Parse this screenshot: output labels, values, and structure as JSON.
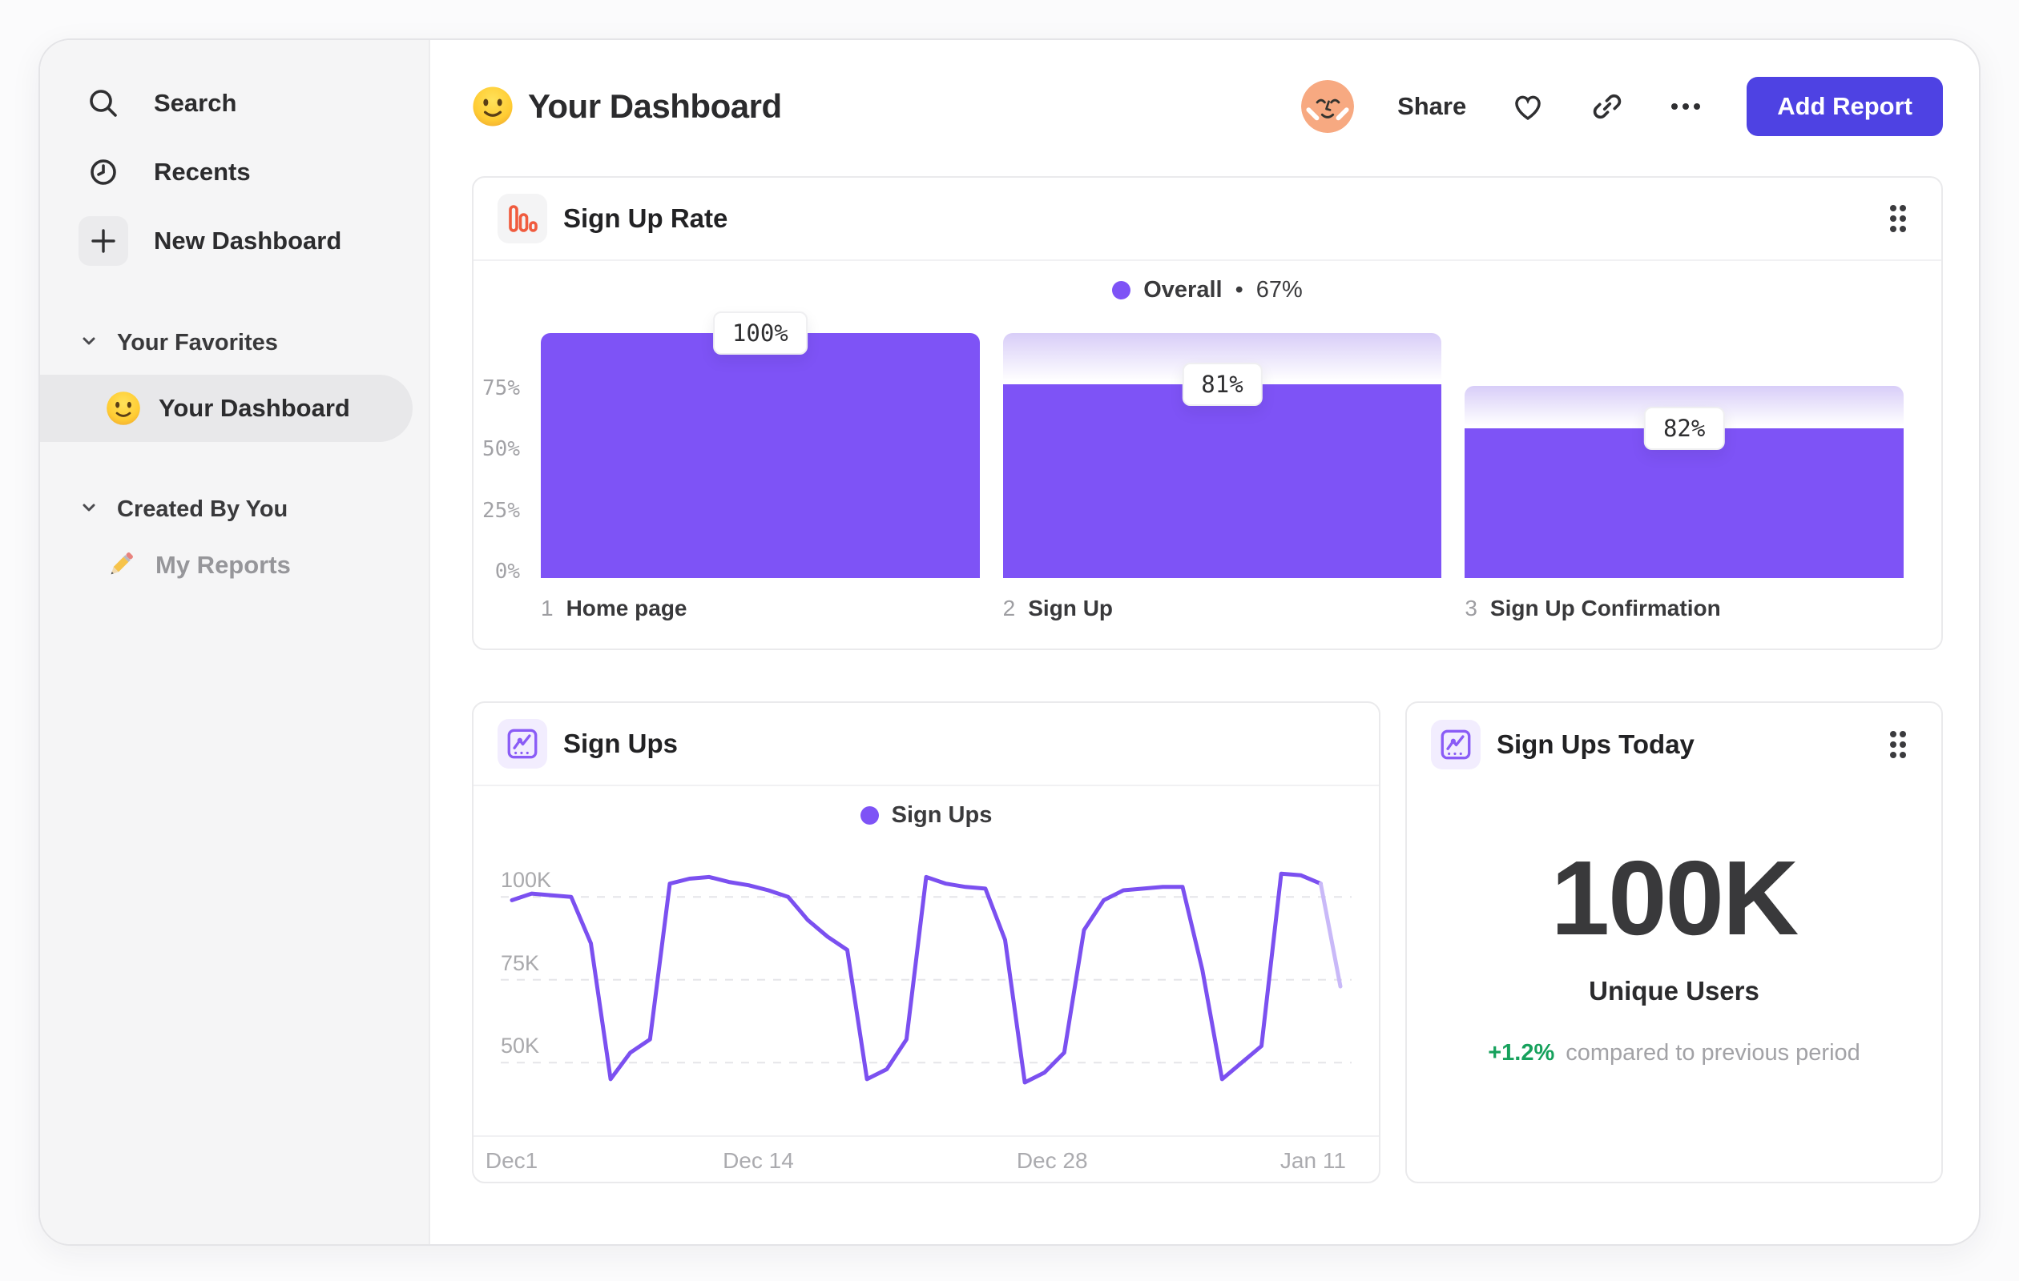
{
  "sidebar": {
    "items": [
      {
        "label": "Search",
        "icon": "search-icon"
      },
      {
        "label": "Recents",
        "icon": "clock-icon"
      },
      {
        "label": "New Dashboard",
        "icon": "plus-icon"
      }
    ],
    "sections": [
      {
        "label": "Your Favorites",
        "items": [
          {
            "label": "Your Dashboard",
            "emoji": "slightly-smiling-face",
            "active": true
          }
        ]
      },
      {
        "label": "Created By You",
        "items": [
          {
            "label": "My Reports",
            "emoji": "pencil",
            "active": false
          }
        ]
      }
    ]
  },
  "header": {
    "title": "Your Dashboard",
    "title_emoji": "slightly-smiling-face",
    "share_label": "Share",
    "add_report_label": "Add Report"
  },
  "cards": {
    "sign_up_rate": {
      "title": "Sign Up Rate"
    },
    "sign_ups": {
      "title": "Sign Ups"
    },
    "sign_ups_today": {
      "title": "Sign Ups Today",
      "value": "100K",
      "value_label": "Unique Users",
      "delta": "+1.2%",
      "delta_note": "compared to previous period"
    }
  },
  "chart_data": [
    {
      "id": "sign_up_rate",
      "type": "bar",
      "title": "Sign Up Rate",
      "legend": {
        "series": "Overall",
        "separator": "•",
        "value": "67%"
      },
      "ylim": [
        0,
        100
      ],
      "y_axis": {
        "ticks": [
          {
            "label": "75%",
            "value": 75
          },
          {
            "label": "50%",
            "value": 50
          },
          {
            "label": "25%",
            "value": 25
          },
          {
            "label": "0%",
            "value": 0
          }
        ]
      },
      "steps": [
        {
          "step": "1",
          "label": "Home page",
          "conversion": "100%",
          "bar_pct": 100,
          "fade_from_pct": 100
        },
        {
          "step": "2",
          "label": "Sign Up",
          "conversion": "81%",
          "bar_pct": 79,
          "fade_from_pct": 100
        },
        {
          "step": "3",
          "label": "Sign Up Confirmation",
          "conversion": "82%",
          "bar_pct": 61,
          "fade_from_pct": 78.5
        }
      ]
    },
    {
      "id": "sign_ups",
      "type": "line",
      "title": "Sign Ups",
      "legend": {
        "series": "Sign Ups"
      },
      "unit": "K",
      "grid": "dashed-horizontal",
      "y_axis": {
        "gridlines": [
          {
            "label": "100K",
            "value": 100
          },
          {
            "label": "75K",
            "value": 75
          },
          {
            "label": "50K",
            "value": 50
          }
        ],
        "value_at_top": 116,
        "value_at_bottom": 30
      },
      "x_axis": {
        "ticks": [
          {
            "label": "Dec1",
            "index": 0
          },
          {
            "label": "Dec 14",
            "index": 13
          },
          {
            "label": "Dec 28",
            "index": 27
          },
          {
            "label": "Jan 11",
            "index": 41
          }
        ]
      },
      "values_k": [
        99,
        101,
        100.5,
        100,
        86,
        45,
        53,
        57,
        104,
        105.5,
        106,
        104.5,
        103.5,
        102,
        100,
        93,
        88,
        84,
        45,
        48,
        57,
        106,
        104,
        103,
        102.5,
        87,
        44,
        47,
        53,
        90,
        99,
        102,
        102.5,
        103,
        103,
        78,
        45,
        50,
        55,
        107,
        106.5,
        104,
        73
      ],
      "faded_tail_segments": 1
    }
  ],
  "colors": {
    "accent_purple": "#7E53F6",
    "funnel_fade_top": "#D8CDF8",
    "line_purple": "#7B50F0",
    "line_faded": "#C9B9F8",
    "button_indigo": "#4E42E3",
    "icon_orange": "#F05B3E",
    "positive_green": "#16A15C",
    "avatar_peach": "#F7A981"
  }
}
